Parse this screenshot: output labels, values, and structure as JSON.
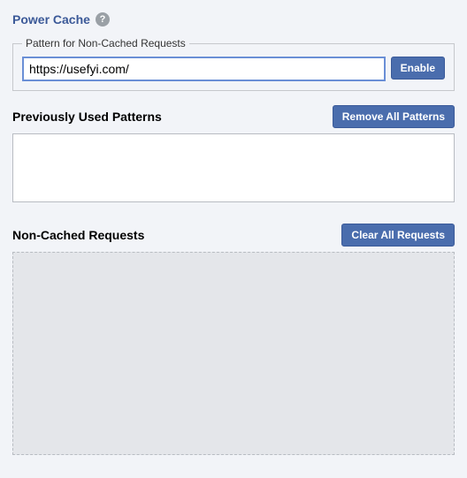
{
  "header": {
    "title": "Power Cache",
    "help_glyph": "?"
  },
  "pattern_input": {
    "legend": "Pattern for Non-Cached Requests",
    "value": "https://usefyi.com/",
    "enable_label": "Enable"
  },
  "previous_patterns": {
    "title": "Previously Used Patterns",
    "remove_all_label": "Remove All Patterns",
    "items": []
  },
  "non_cached": {
    "title": "Non-Cached Requests",
    "clear_all_label": "Clear All Requests",
    "items": []
  }
}
